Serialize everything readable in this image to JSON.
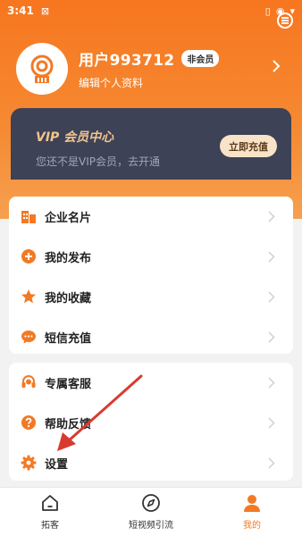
{
  "status_bar": {
    "time": "3:41"
  },
  "profile": {
    "username": "用户993712",
    "member_badge": "非会员",
    "edit_link": "编辑个人资料"
  },
  "vip": {
    "title": "VIP 会员中心",
    "subtitle": "您还不是VIP会员，去开通",
    "button_label": "立即充值"
  },
  "menu_group_1": [
    {
      "label": "企业名片",
      "icon": "building-icon"
    },
    {
      "label": "我的发布",
      "icon": "plus-circle-icon"
    },
    {
      "label": "我的收藏",
      "icon": "star-icon"
    },
    {
      "label": "短信充值",
      "icon": "chat-bubble-icon"
    }
  ],
  "menu_group_2": [
    {
      "label": "专属客服",
      "icon": "headset-icon"
    },
    {
      "label": "帮助反馈",
      "icon": "question-circle-icon"
    },
    {
      "label": "设置",
      "icon": "gear-icon"
    }
  ],
  "bottom_nav": [
    {
      "label": "拓客",
      "icon": "home-icon"
    },
    {
      "label": "短视频引流",
      "icon": "compass-icon"
    },
    {
      "label": "我的",
      "icon": "person-icon"
    }
  ],
  "colors": {
    "accent": "#f27a25",
    "vip_bg": "#3d4256",
    "vip_gold": "#f2c48d",
    "annotation_arrow": "#d93a2f"
  }
}
